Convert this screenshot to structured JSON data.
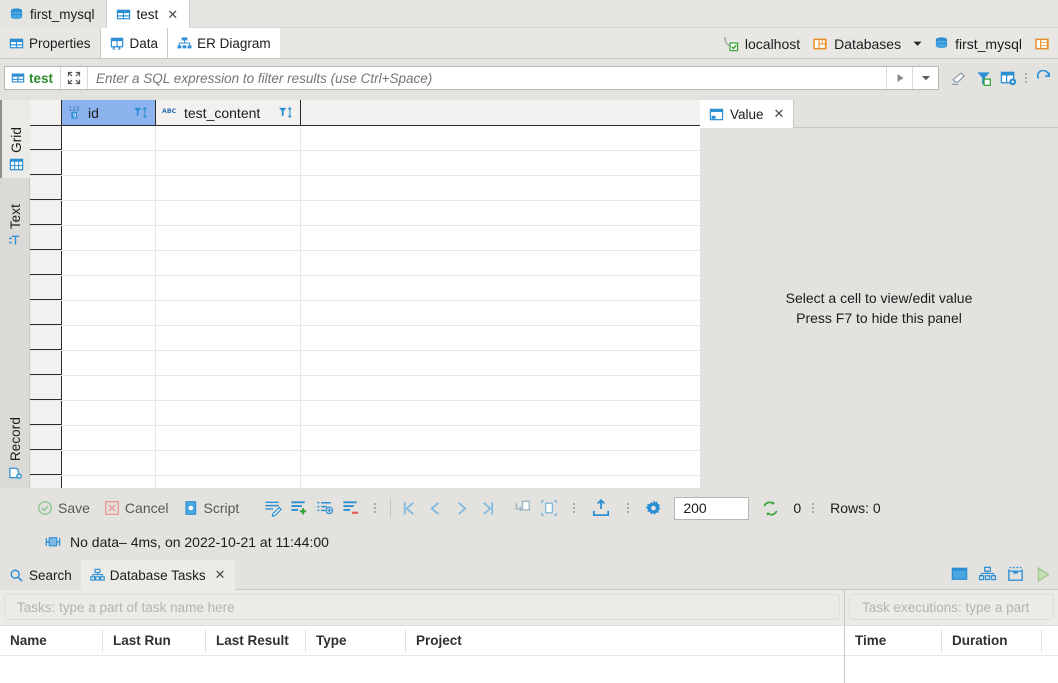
{
  "editor_tabs": [
    {
      "label": "first_mysql",
      "icon": "database-icon",
      "active": false,
      "closable": false
    },
    {
      "label": "test",
      "icon": "table-icon",
      "active": true,
      "closable": true
    }
  ],
  "page_tabs": [
    {
      "label": "Properties",
      "icon": "table-properties-icon",
      "active": false
    },
    {
      "label": "Data",
      "icon": "data-grid-icon",
      "active": true
    },
    {
      "label": "ER Diagram",
      "icon": "er-diagram-icon",
      "active": false
    }
  ],
  "breadcrumbs": {
    "connection": "localhost",
    "databases": "Databases",
    "schema": "first_mysql"
  },
  "filter": {
    "table_name": "test",
    "placeholder": "Enter a SQL expression to filter results (use Ctrl+Space)",
    "value": ""
  },
  "left_tabs": [
    {
      "label": "Grid",
      "icon": "grid-icon",
      "active": true
    },
    {
      "label": "Text",
      "icon": "text-icon",
      "active": false
    },
    {
      "label": "Record",
      "icon": "record-icon",
      "active": false
    }
  ],
  "grid": {
    "columns": [
      {
        "name": "id",
        "type_icon": "numeric-123-icon",
        "selected": true
      },
      {
        "name": "test_content",
        "type_icon": "abc-text-icon",
        "selected": false
      }
    ],
    "rows": [],
    "visible_empty_rows": 15
  },
  "value_panel": {
    "tab_label": "Value",
    "message_line1": "Select a cell to view/edit value",
    "message_line2": "Press F7 to hide this panel"
  },
  "grid_toolbar": {
    "save_label": "Save",
    "cancel_label": "Cancel",
    "script_label": "Script",
    "row_limit": "200",
    "fetched_count": "0",
    "rows_label": "Rows: 0"
  },
  "status": {
    "text": "No data– 4ms, on 2022-10-21 at 11:44:00"
  },
  "bottom_panel": {
    "tabs": [
      {
        "label": "Search",
        "icon": "search-icon",
        "active": false,
        "closable": false
      },
      {
        "label": "Database Tasks",
        "icon": "tasks-icon",
        "active": true,
        "closable": true
      }
    ],
    "tasks": {
      "search_placeholder": "Tasks: type a part of task name here",
      "columns": [
        "Name",
        "Last Run",
        "Last Result",
        "Type",
        "Project"
      ],
      "rows": []
    },
    "executions": {
      "search_placeholder": "Task executions: type a part",
      "columns": [
        "Time",
        "Duration"
      ],
      "rows": []
    }
  },
  "colors": {
    "accent_blue": "#2c8fd4",
    "selection_blue": "#8cb3ee",
    "orange": "#e8912a",
    "green": "#3aa33a",
    "red": "#e35a52",
    "chrome_bg": "#e4e2df"
  }
}
